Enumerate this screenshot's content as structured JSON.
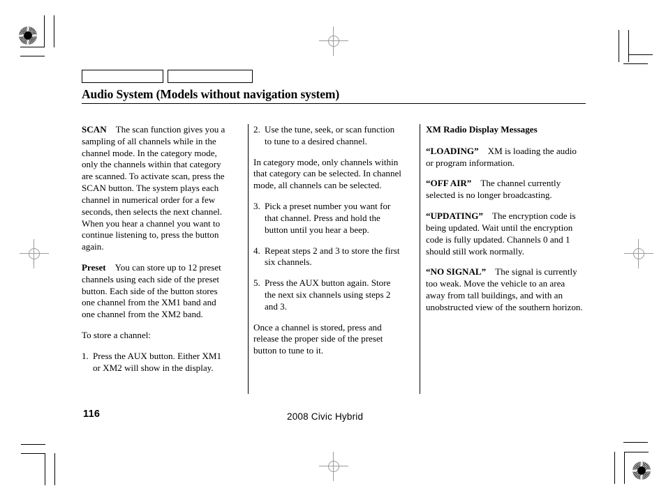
{
  "document": {
    "title": "Audio System (Models without navigation system)",
    "tabs": [
      {
        "label": ""
      },
      {
        "label": ""
      }
    ]
  },
  "columns": {
    "col1": {
      "scan": {
        "lead": "SCAN",
        "body": "The scan function gives you a sampling of all channels while in the channel mode. In the category mode, only the channels within that category are scanned. To activate scan, press the SCAN button. The system plays each channel in numerical order for a few seconds, then selects the next channel. When you hear a channel you want to continue listening to, press the button again."
      },
      "preset": {
        "lead": "Preset",
        "body": "You can store up to 12 preset channels using each side of the preset button. Each side of the button stores one channel from the XM1 band and one channel from the XM2 band."
      },
      "store_intro": "To store a channel:",
      "step1": {
        "num": "1.",
        "text": "Press the AUX button. Either XM1 or XM2 will show in the display."
      }
    },
    "col2": {
      "step2": {
        "num": "2.",
        "text": "Use the tune, seek, or scan function to tune to a desired channel."
      },
      "category_note": "In category mode, only channels within that category can be selected. In channel mode, all channels can be selected.",
      "step3": {
        "num": "3.",
        "text": "Pick a preset number you want for that channel. Press and hold the button until you hear a beep."
      },
      "step4": {
        "num": "4.",
        "text": "Repeat steps 2 and 3 to store the first six channels."
      },
      "step5": {
        "num": "5.",
        "text": "Press the AUX button again. Store the next six channels using steps 2 and 3."
      },
      "closing": "Once a channel is stored, press and release the proper side of the preset button to tune to it."
    },
    "col3": {
      "heading": "XM Radio Display Messages",
      "messages": [
        {
          "term": "“LOADING”",
          "body": "XM is loading the audio or program information."
        },
        {
          "term": "“OFF AIR”",
          "body": "The channel currently selected is no longer broadcasting."
        },
        {
          "term": "“UPDATING”",
          "body": "The encryption code is being updated. Wait until the encryption code is fully updated. Channels 0 and 1 should still work normally."
        },
        {
          "term": "“NO SIGNAL”",
          "body": "The signal is currently too weak. Move the vehicle to an area away from tall buildings, and with an unobstructed view of the southern horizon."
        }
      ]
    }
  },
  "footer": {
    "page_number": "116",
    "model": "2008  Civic  Hybrid"
  }
}
